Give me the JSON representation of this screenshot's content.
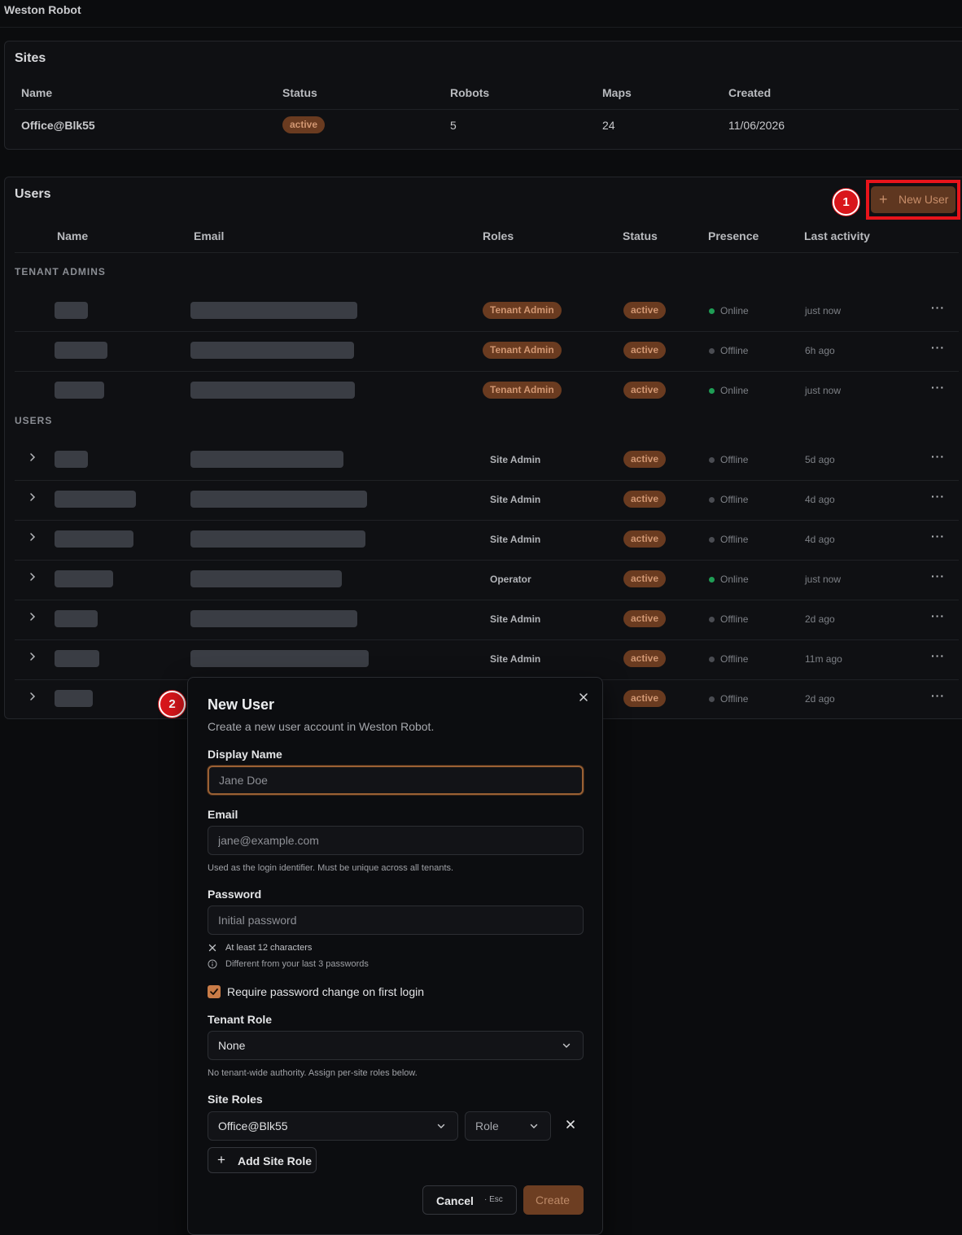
{
  "app": {
    "brand": "Weston Robot"
  },
  "sites": {
    "title": "Sites",
    "columns": [
      "Name",
      "Status",
      "Robots",
      "Maps",
      "Created"
    ],
    "rows": [
      {
        "name": "Office@Blk55",
        "status": "active",
        "robots": "5",
        "maps": "24",
        "created": "11/06/2026"
      }
    ]
  },
  "users": {
    "title": "Users",
    "new_user_label": "New User",
    "columns": [
      "Name",
      "Email",
      "Roles",
      "Status",
      "Presence",
      "Last activity"
    ],
    "group_tenant_admins": "TENANT ADMINS",
    "group_users": "USERS",
    "tenant_admins": [
      {
        "role": "Tenant Admin",
        "status": "active",
        "presence": "Online",
        "last": "just now"
      },
      {
        "role": "Tenant Admin",
        "status": "active",
        "presence": "Offline",
        "last": "6h ago"
      },
      {
        "role": "Tenant Admin",
        "status": "active",
        "presence": "Online",
        "last": "just now"
      }
    ],
    "rows": [
      {
        "role": "Site Admin",
        "status": "active",
        "presence": "Offline",
        "last": "5d ago"
      },
      {
        "role": "Site Admin",
        "status": "active",
        "presence": "Offline",
        "last": "4d ago"
      },
      {
        "role": "Site Admin",
        "status": "active",
        "presence": "Offline",
        "last": "4d ago"
      },
      {
        "role": "Operator",
        "status": "active",
        "presence": "Online",
        "last": "just now"
      },
      {
        "role": "Site Admin",
        "status": "active",
        "presence": "Offline",
        "last": "2d ago"
      },
      {
        "role": "Site Admin",
        "status": "active",
        "presence": "Offline",
        "last": "11m ago"
      },
      {
        "role": "",
        "status": "active",
        "presence": "Offline",
        "last": "2d ago"
      }
    ]
  },
  "annotations": {
    "marker_1": "1",
    "marker_2": "2"
  },
  "modal": {
    "title": "New User",
    "subtitle": "Create a new user account in Weston Robot.",
    "display_name_label": "Display Name",
    "display_name_placeholder": "Jane Doe",
    "email_label": "Email",
    "email_placeholder": "jane@example.com",
    "email_help": "Used as the login identifier. Must be unique across all tenants.",
    "password_label": "Password",
    "password_placeholder": "Initial password",
    "rule_length": "At least 12 characters",
    "rule_history": "Different from your last 3 passwords",
    "require_change_label": "Require password change on first login",
    "require_change_checked": true,
    "tenant_role_label": "Tenant Role",
    "tenant_role_value": "None",
    "tenant_role_help": "No tenant-wide authority. Assign per-site roles below.",
    "site_roles_label": "Site Roles",
    "site_value": "Office@Blk55",
    "role_placeholder": "Role",
    "add_site_role_label": "Add Site Role",
    "cancel_label": "Cancel",
    "cancel_shortcut": "· Esc",
    "create_label": "Create"
  },
  "colors": {
    "accent": "#c97b47",
    "pill_bg": "#6a3b20",
    "online": "#1f9d55",
    "highlight": "#e8141b"
  }
}
